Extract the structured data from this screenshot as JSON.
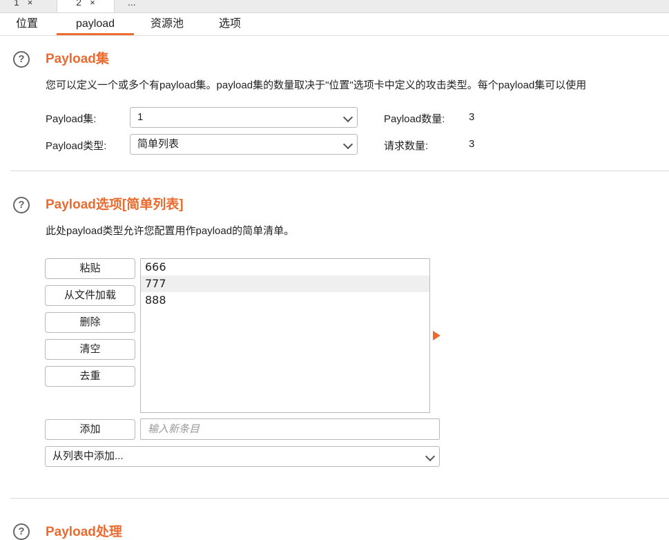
{
  "request_tabs": [
    {
      "label": "1",
      "close": "×"
    },
    {
      "label": "2",
      "close": "×"
    },
    {
      "label": "..."
    }
  ],
  "subtabs": [
    "位置",
    "payload",
    "资源池",
    "选项"
  ],
  "payload_sets": {
    "title": "Payload集",
    "description": "您可以定义一个或多个有payload集。payload集的数量取决于\"位置\"选项卡中定义的攻击类型。每个payload集可以使用",
    "set_label": "Payload集:",
    "set_value": "1",
    "type_label": "Payload类型:",
    "type_value": "简单列表",
    "count_label": "Payload数量:",
    "count_value": "3",
    "requests_label": "请求数量:",
    "requests_value": "3"
  },
  "payload_options": {
    "title": "Payload选项[简单列表]",
    "description": "此处payload类型允许您配置用作payload的简单清单。",
    "buttons": [
      "粘贴",
      "从文件加载",
      "删除",
      "清空",
      "去重"
    ],
    "items": [
      "666",
      "777",
      "888"
    ],
    "selected_index": 1,
    "add_button": "添加",
    "add_placeholder": "输入新条目",
    "add_from_list": "从列表中添加..."
  },
  "payload_processing": {
    "title": "Payload处理"
  },
  "colors": {
    "accent": "#ec6a2e"
  },
  "icons": {
    "help": "question-circle-icon",
    "dropdown": "chevron-down-icon",
    "run": "triangle-right-icon"
  }
}
